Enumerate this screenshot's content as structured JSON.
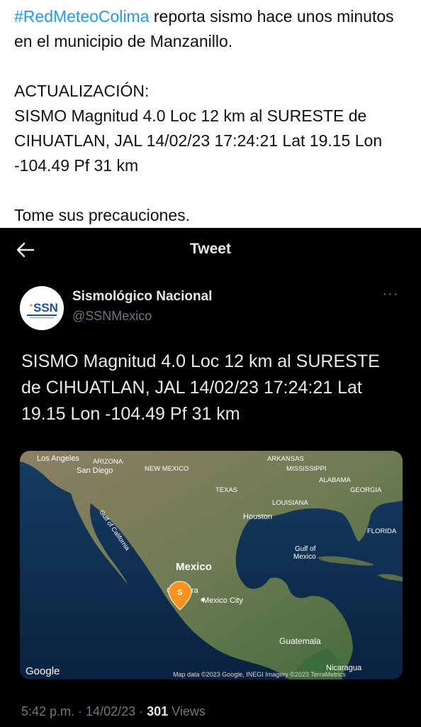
{
  "post": {
    "hashtag": "#RedMeteoColima",
    "line1_rest": " reporta sismo hace unos minutos en el municipio de Manzanillo.",
    "update_heading": "ACTUALIZACIÓN:",
    "update_body": "SISMO Magnitud 4.0 Loc  12 km al SURESTE de CIHUATLAN, JAL 14/02/23 17:24:21 Lat 19.15 Lon -104.49 Pf 31 km",
    "closing": "Tome sus precauciones."
  },
  "embed": {
    "title": "Tweet",
    "author": {
      "name": "Sismológico Nacional",
      "handle": "@SSNMexico",
      "avatar_text": "SSN"
    },
    "text": "SISMO Magnitud 4.0 Loc  12 km al SURESTE de CIHUATLAN, JAL 14/02/23 17:24:21 Lat 19.15 Lon -104.49 Pf 31 km",
    "map": {
      "labels": {
        "los_angeles": "Los Angeles",
        "arizona": "ARIZONA",
        "san_diego": "San Diego",
        "new_mexico": "NEW MEXICO",
        "arkansas": "ARKANSAS",
        "mississippi": "MISSISSIPPI",
        "alabama": "ALABAMA",
        "georgia": "GEORGIA",
        "texas": "TEXAS",
        "louisiana": "LOUISIANA",
        "houston": "Houston",
        "florida": "FLORIDA",
        "gulf_of_california": "Gulf of California",
        "gulf_of_mexico_1": "Gulf of",
        "gulf_of_mexico_2": "Mexico",
        "mexico": "Mexico",
        "guadalajara": "G  alajara",
        "mexico_city": "Mexico City",
        "guatemala": "Guatemala",
        "nicaragua": "Nicaragua"
      },
      "marker_label": "S",
      "google": "Google",
      "attribution": "Map data ©2023 Google, INEGI Imagery ©2023 TerraMetrics"
    },
    "time": "5:42 p.m.",
    "sep": " · ",
    "date": "14/02/23",
    "views_count": "301",
    "views_label": " Views"
  },
  "colors": {
    "link": "#1d9bf0",
    "embed_bg": "#000000",
    "marker": "#f7931e"
  }
}
